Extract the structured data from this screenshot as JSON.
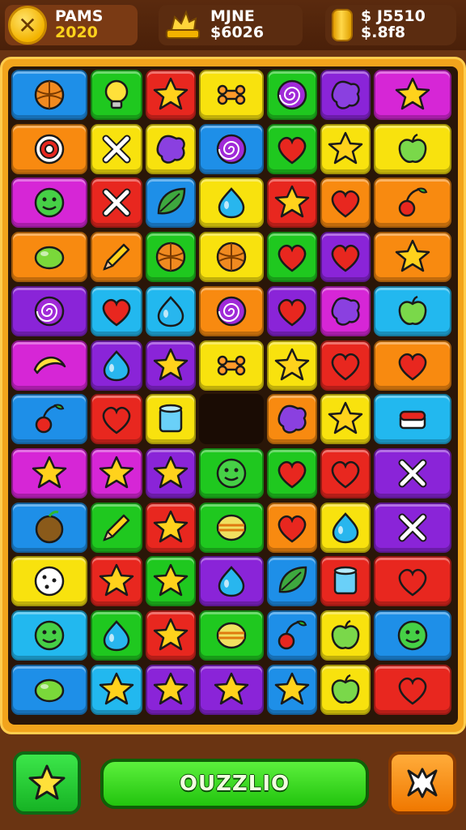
{
  "hud": {
    "left": {
      "line1": "PAMS",
      "line2": "2020"
    },
    "middle": {
      "line1": "MJNE",
      "line2": "$6026"
    },
    "right": {
      "line1": "$ J5510",
      "line2": "$.8f8"
    }
  },
  "footer": {
    "main_label": "OUZZLIO"
  },
  "colors": {
    "blue": "#1e8fe8",
    "green": "#1fc81f",
    "red": "#e8271f",
    "yellow": "#f8e20e",
    "purple": "#8a24d8",
    "magenta": "#d626d6",
    "orange": "#f88a10",
    "cyan": "#22b8ef"
  },
  "board": {
    "rows": [
      [
        [
          "blue",
          "ball"
        ],
        [
          "green",
          "bulb"
        ],
        [
          "red",
          "star"
        ],
        [
          "yellow",
          "bone"
        ],
        [
          "green",
          "swirl"
        ],
        [
          "purple",
          "blob"
        ],
        [
          "magenta",
          "star"
        ]
      ],
      [
        [
          "orange",
          "target"
        ],
        [
          "yellow",
          "x"
        ],
        [
          "yellow",
          "blob"
        ],
        [
          "blue",
          "swirl"
        ],
        [
          "green",
          "heart"
        ],
        [
          "yellow",
          "star"
        ],
        [
          "yellow",
          "apple"
        ]
      ],
      [
        [
          "magenta",
          "face"
        ],
        [
          "red",
          "x"
        ],
        [
          "blue",
          "leaf"
        ],
        [
          "yellow",
          "drop"
        ],
        [
          "red",
          "star"
        ],
        [
          "orange",
          "heart"
        ],
        [
          "orange",
          "cherry"
        ]
      ],
      [
        [
          "orange",
          "lemon"
        ],
        [
          "orange",
          "pencil"
        ],
        [
          "green",
          "ball"
        ],
        [
          "yellow",
          "ball"
        ],
        [
          "green",
          "heart"
        ],
        [
          "purple",
          "heart"
        ],
        [
          "orange",
          "star"
        ]
      ],
      [
        [
          "purple",
          "swirl"
        ],
        [
          "cyan",
          "heart"
        ],
        [
          "cyan",
          "drop"
        ],
        [
          "orange",
          "swirl"
        ],
        [
          "purple",
          "heart"
        ],
        [
          "magenta",
          "blob"
        ],
        [
          "cyan",
          "apple"
        ]
      ],
      [
        [
          "magenta",
          "banana"
        ],
        [
          "purple",
          "drop"
        ],
        [
          "purple",
          "star"
        ],
        [
          "yellow",
          "bone"
        ],
        [
          "yellow",
          "star"
        ],
        [
          "red",
          "heart"
        ],
        [
          "orange",
          "heart"
        ]
      ],
      [
        [
          "blue",
          "cherry"
        ],
        [
          "red",
          "heart"
        ],
        [
          "yellow",
          "cylinder"
        ],
        [
          "empty",
          ""
        ],
        [
          "orange",
          "blob"
        ],
        [
          "yellow",
          "star"
        ],
        [
          "cyan",
          "cake"
        ]
      ],
      [
        [
          "magenta",
          "star"
        ],
        [
          "magenta",
          "star"
        ],
        [
          "purple",
          "star"
        ],
        [
          "green",
          "face"
        ],
        [
          "green",
          "heart"
        ],
        [
          "red",
          "heart"
        ],
        [
          "purple",
          "x"
        ]
      ],
      [
        [
          "blue",
          "coconut"
        ],
        [
          "green",
          "pencil"
        ],
        [
          "red",
          "star"
        ],
        [
          "green",
          "melon"
        ],
        [
          "orange",
          "heart"
        ],
        [
          "yellow",
          "drop"
        ],
        [
          "purple",
          "x"
        ]
      ],
      [
        [
          "yellow",
          "cookie"
        ],
        [
          "red",
          "star"
        ],
        [
          "green",
          "star"
        ],
        [
          "purple",
          "drop"
        ],
        [
          "blue",
          "leaf"
        ],
        [
          "red",
          "cylinder"
        ],
        [
          "red",
          "heart"
        ]
      ],
      [
        [
          "cyan",
          "face"
        ],
        [
          "green",
          "drop"
        ],
        [
          "red",
          "star"
        ],
        [
          "green",
          "melon"
        ],
        [
          "blue",
          "cherry"
        ],
        [
          "yellow",
          "apple"
        ],
        [
          "blue",
          "face"
        ]
      ],
      [
        [
          "blue",
          "lemon"
        ],
        [
          "cyan",
          "star"
        ],
        [
          "purple",
          "star"
        ],
        [
          "purple",
          "star"
        ],
        [
          "blue",
          "star"
        ],
        [
          "yellow",
          "apple"
        ],
        [
          "red",
          "heart"
        ]
      ]
    ]
  }
}
